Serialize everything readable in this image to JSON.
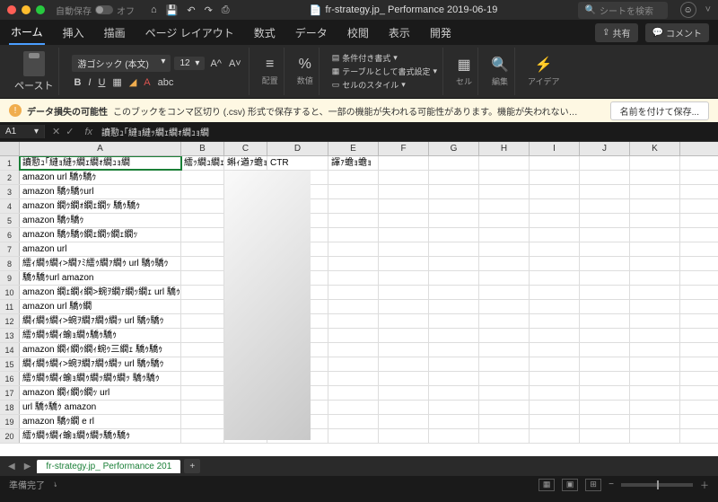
{
  "titlebar": {
    "autosave_label": "自動保存",
    "autosave_state": "オフ",
    "doc_icon": "📄",
    "doc_title": "fr-strategy.jp_ Performance 2019-06-19",
    "search_placeholder": "シートを検索"
  },
  "tabs": {
    "items": [
      "ホーム",
      "挿入",
      "描画",
      "ページ レイアウト",
      "数式",
      "データ",
      "校閲",
      "表示",
      "開発"
    ],
    "share": "共有",
    "comment": "コメント"
  },
  "ribbon": {
    "paste": "ペースト",
    "font_name": "游ゴシック (本文)",
    "font_size": "12",
    "align": "配置",
    "number": "数値",
    "cond_format": "条件付き書式",
    "table_format": "テーブルとして書式設定",
    "cell_styles": "セルのスタイル",
    "cells": "セル",
    "edit": "編集",
    "ideas": "アイデア"
  },
  "warning": {
    "title": "データ損失の可能性",
    "msg": "このブックをコンマ区切り (.csv) 形式で保存すると、一部の機能が失われる可能性があります。機能が失われない…",
    "btn": "名前を付けて保存..."
  },
  "formula": {
    "cell_ref": "A1",
    "value": "讀懃ｭ｢縺ｮ縺ｯ繝ｪ繝ｫ繝ｭｮ繝"
  },
  "columns": [
    "A",
    "B",
    "C",
    "D",
    "E",
    "F",
    "G",
    "H",
    "I",
    "J",
    "K"
  ],
  "rows": [
    {
      "n": 1,
      "A": "讀懃ｭ｢縺ｮ縺ｯ繝ｪ繝ｫ繝ｭｮ繝",
      "B": "繧ｯ繝ｭ繝ｪ縺ｸ隱",
      "C": "蝌ｨ遒ｧ蟾ｮ繝",
      "D": "CTR",
      "E": "諢ｧ蟾ｮ蟾ｮ"
    },
    {
      "n": 2,
      "A": "amazon url 驕ｩ驕ｩ"
    },
    {
      "n": 3,
      "A": "amazon 驕ｩ驕ｩurl"
    },
    {
      "n": 4,
      "A": "amazon 繝ｩ繝ｫ繝ｪ繝ｯ 驕ｩ驕ｩ"
    },
    {
      "n": 5,
      "A": "amazon 驕ｩ驕ｩ"
    },
    {
      "n": 6,
      "A": "amazon 驕ｩ驕ｩ繝ｪ繝ｯ繝ｪ繝ｯ"
    },
    {
      "n": 7,
      "A": "amazon url"
    },
    {
      "n": 8,
      "A": "繧ｨ繝ｩ繝ｨ>繝ｧﾐ繧ｩ繝ｧ繝ｩ url 驕ｩ驕ｩ"
    },
    {
      "n": 9,
      "A": "驕ｩ驕ｩurl amazon"
    },
    {
      "n": 10,
      "A": "amazon 繝ｪ繝ｨ繝>蜿ｦ繝ｧ繝ｯ繝ｪ url 驕ｩ驕"
    },
    {
      "n": 11,
      "A": "amazon url 驕ｩ繝"
    },
    {
      "n": 12,
      "A": "繝ｨ繝ｩ繝ｨ>蜿ｦ繝ｧ繝ｩ繝ｯ url 驕ｩ驕ｩ"
    },
    {
      "n": 13,
      "A": "繧ｩ繝ｩ繝ｨ蝓ｮ繝ｩ驕ｩ驕ｩ"
    },
    {
      "n": 14,
      "A": "amazon 繝ｨ繝ｩ繝ｨ蜿ｩ三繝ｪ 驕ｩ驕ｩ"
    },
    {
      "n": 15,
      "A": "繝ｨ繝ｩ繝ｨ>蜿ｦ繝ｧ繝ｩ繝ｯ url 驕ｩ驕ｩ"
    },
    {
      "n": 16,
      "A": "繧ｩ繝ｩ繝ｨ蝓ｮ繝ｩ繝ｯ繝ｩ繝ｯ 驕ｩ驕ｩ"
    },
    {
      "n": 17,
      "A": "amazon 繝ｨ繝ｩ繝ｯ url"
    },
    {
      "n": 18,
      "A": "url 驕ｩ驕ｩ amazon"
    },
    {
      "n": 19,
      "A": "amazon 驕ｩ繝 e rl"
    },
    {
      "n": 20,
      "A": "繧ｩ繝ｩ繝ｨ蝓ｮ繝ｩ繝ｯ驕ｩ驕ｩ"
    }
  ],
  "sheet": {
    "name": "fr-strategy.jp_ Performance 201"
  },
  "status": {
    "ready": "準備完了",
    "zoom_out": "−",
    "zoom_in": "＋"
  }
}
